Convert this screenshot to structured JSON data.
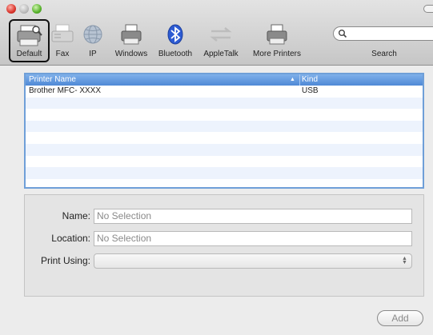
{
  "window": {
    "controls": [
      "close",
      "minimize",
      "zoom"
    ]
  },
  "toolbar": {
    "items": [
      {
        "label": "Default",
        "icon": "default-printer-icon",
        "selected": true
      },
      {
        "label": "Fax",
        "icon": "fax-icon",
        "selected": false
      },
      {
        "label": "IP",
        "icon": "ip-globe-icon",
        "selected": false
      },
      {
        "label": "Windows",
        "icon": "windows-printer-icon",
        "selected": false
      },
      {
        "label": "Bluetooth",
        "icon": "bluetooth-icon",
        "selected": false
      },
      {
        "label": "AppleTalk",
        "icon": "appletalk-icon",
        "selected": false
      },
      {
        "label": "More Printers",
        "icon": "more-printers-icon",
        "selected": false
      }
    ],
    "search": {
      "value": "",
      "placeholder": "",
      "label": "Search"
    }
  },
  "printer_table": {
    "columns": [
      "Printer Name",
      "Kind"
    ],
    "sort_indicator": "▲",
    "rows": [
      {
        "name": "Brother MFC- XXXX",
        "kind": "USB"
      },
      {
        "name": "",
        "kind": ""
      },
      {
        "name": "",
        "kind": ""
      },
      {
        "name": "",
        "kind": ""
      },
      {
        "name": "",
        "kind": ""
      },
      {
        "name": "",
        "kind": ""
      },
      {
        "name": "",
        "kind": ""
      },
      {
        "name": "",
        "kind": ""
      }
    ]
  },
  "details": {
    "name_label": "Name:",
    "name_value": "No Selection",
    "location_label": "Location:",
    "location_value": "No Selection",
    "print_using_label": "Print Using:",
    "print_using_value": ""
  },
  "add_button": {
    "label": "Add",
    "enabled": false
  },
  "colors": {
    "header_blue": "#5a93dc",
    "row_stripe": "#edf3fd",
    "selection_border": "#111111"
  }
}
